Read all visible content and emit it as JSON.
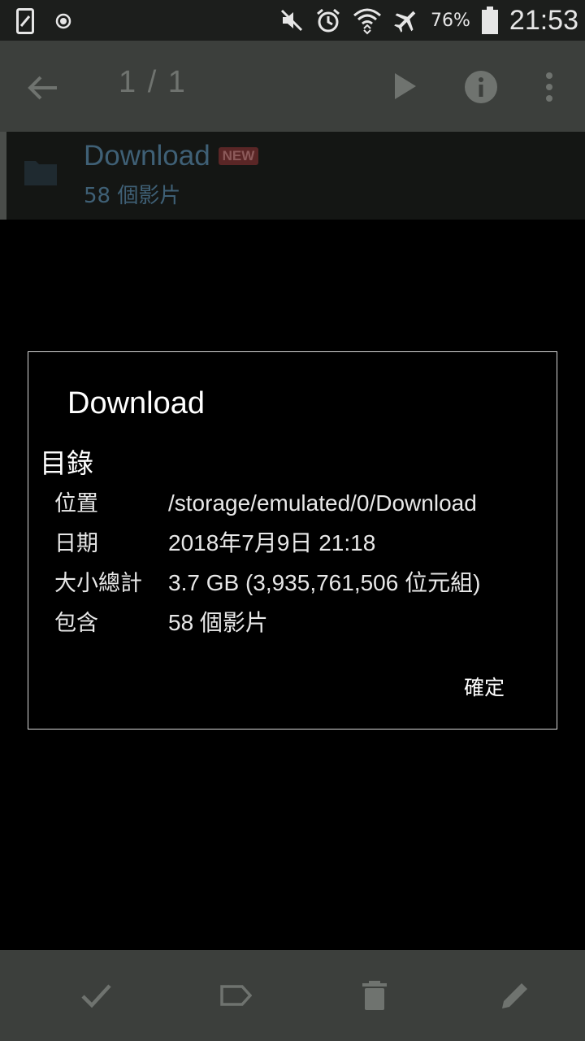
{
  "status_bar": {
    "battery_percent": "76%",
    "time": "21:53",
    "icons": [
      "sim-icon",
      "record-icon",
      "mute-icon",
      "alarm-icon",
      "wifi-icon",
      "airplane-icon",
      "battery-icon"
    ]
  },
  "app_bar": {
    "counter": "1 / 1",
    "icons": [
      "back-arrow-icon",
      "play-icon",
      "info-icon",
      "more-vert-icon"
    ]
  },
  "list_item": {
    "title": "Download",
    "badge": "NEW",
    "subtitle": "58 個影片"
  },
  "dialog": {
    "title": "Download",
    "section": "目錄",
    "rows": [
      {
        "label": "位置",
        "value": "/storage/emulated/0/Download"
      },
      {
        "label": "日期",
        "value": "2018年7月9日 21:18"
      },
      {
        "label": "大小總計",
        "value": "3.7 GB (3,935,761,506 位元組)"
      },
      {
        "label": "包含",
        "value": "58 個影片"
      }
    ],
    "ok_label": "確定"
  },
  "bottom_bar": {
    "icons": [
      "check-icon",
      "label-icon",
      "trash-icon",
      "edit-icon"
    ]
  },
  "colors": {
    "app_bar_bg": "#3c3f3c",
    "list_text": "#3f6076",
    "badge_bg": "#5a2626"
  }
}
